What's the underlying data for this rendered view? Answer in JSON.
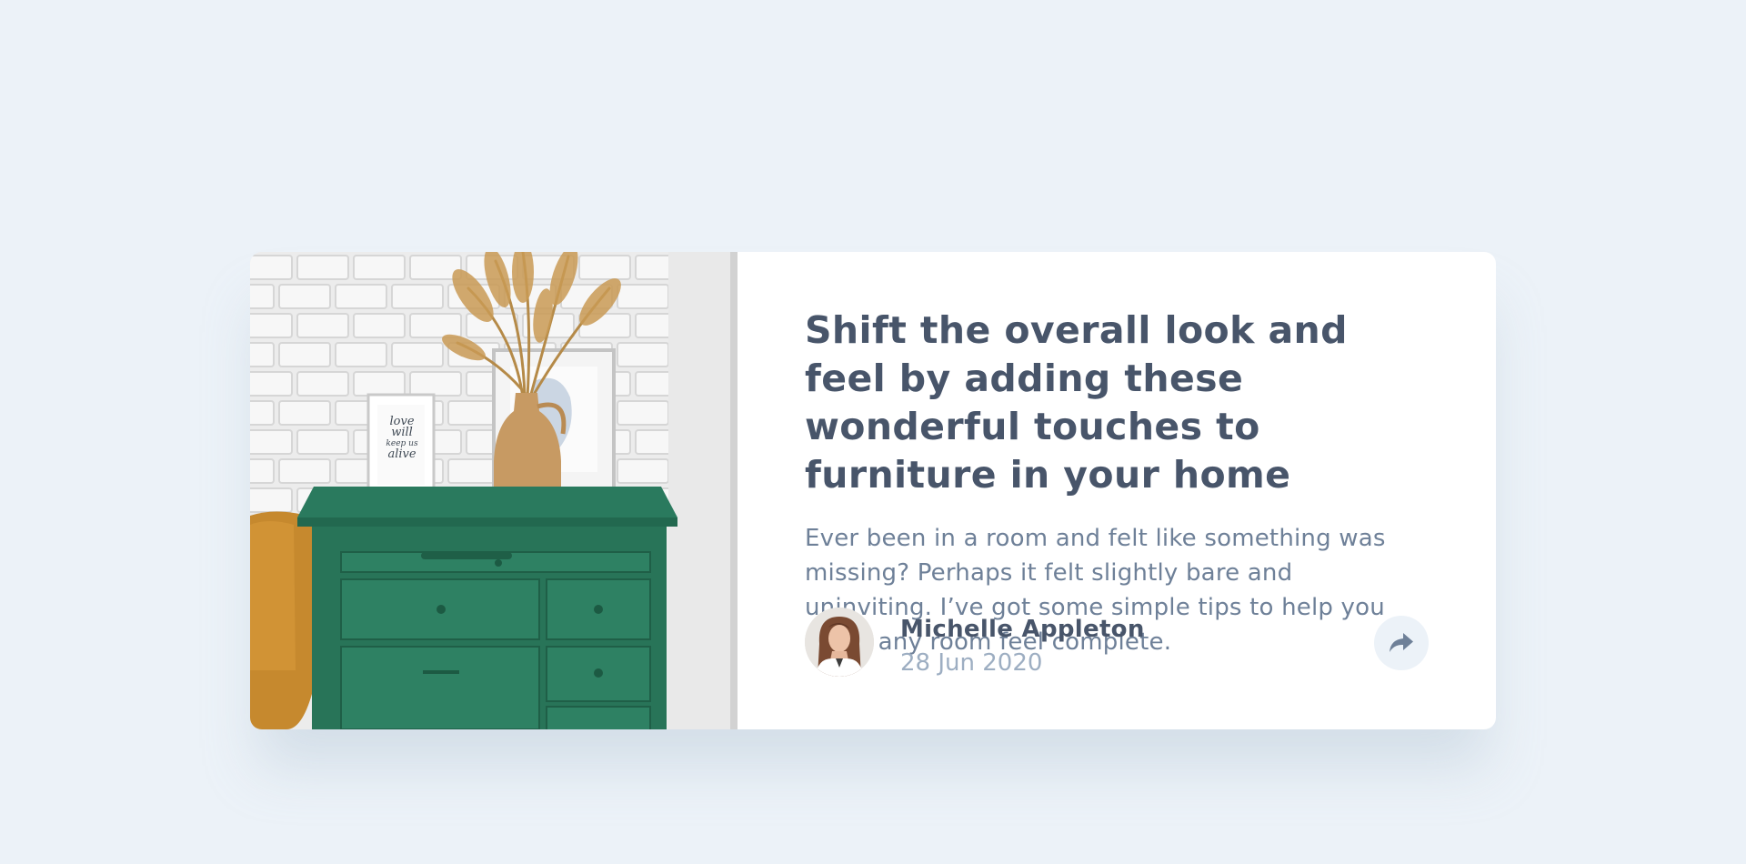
{
  "article": {
    "title": "Shift the overall look and feel by adding these wonderful touches to furniture in your home",
    "description": "Ever been in a room and felt like something was missing? Perhaps it felt slightly bare and uninviting. I’ve got some simple tips to help you make any room feel complete.",
    "image_icon": "drawers-photo",
    "frame_text": [
      "love",
      "will",
      "keep us",
      "alive"
    ]
  },
  "author": {
    "name": "Michelle Appleton",
    "date": "28 Jun 2020",
    "avatar_icon": "avatar-photo"
  },
  "share": {
    "icon": "share-icon"
  },
  "colors": {
    "background": "#ecf2f8",
    "card": "#ffffff",
    "heading": "#48556a",
    "body": "#6e8098",
    "muted": "#9daec2",
    "share_bg": "#ecf2f8",
    "share_icon": "#6e8098"
  }
}
